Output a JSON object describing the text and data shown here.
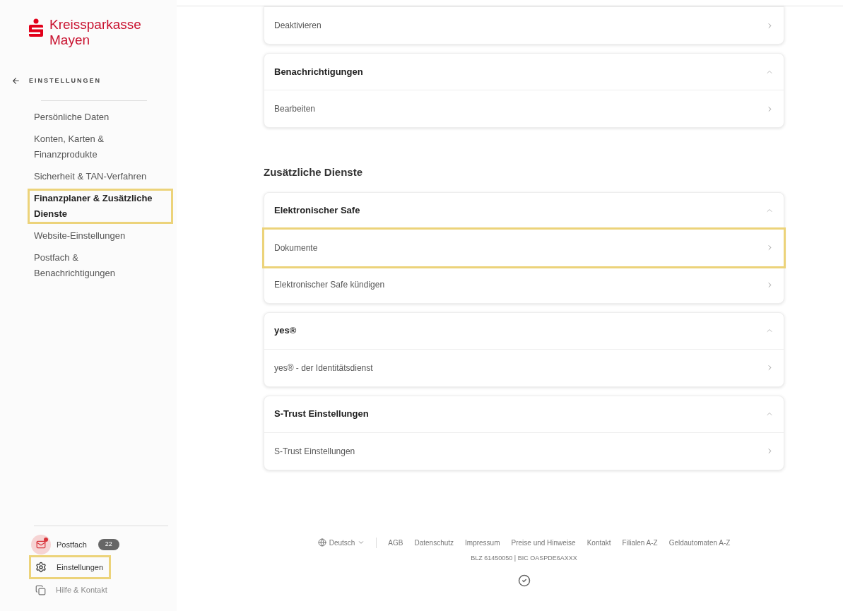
{
  "sidebar": {
    "logo": {
      "line1": "Kreissparkasse",
      "line2": "Mayen"
    },
    "back_label": "EINSTELLUNGEN",
    "items": [
      {
        "label": "Persönliche Daten",
        "selected": false,
        "highlighted": false
      },
      {
        "label": "Konten, Karten & Finanzprodukte",
        "selected": false,
        "highlighted": false
      },
      {
        "label": "Sicherheit & TAN-Verfahren",
        "selected": false,
        "highlighted": false
      },
      {
        "label": "Finanzplaner & Zusätzliche Dienste",
        "selected": true,
        "highlighted": true
      },
      {
        "label": "Website-Einstellungen",
        "selected": false,
        "highlighted": false
      },
      {
        "label": "Postfach & Benachrichtigungen",
        "selected": false,
        "highlighted": false
      }
    ],
    "bottom_items": [
      {
        "kind": "mail",
        "label": "Postfach",
        "badge": "22",
        "highlighted": false
      },
      {
        "kind": "settings",
        "label": "Einstellungen",
        "highlighted": true
      },
      {
        "kind": "help",
        "label": "Hilfe & Kontakt",
        "highlighted": false
      }
    ]
  },
  "main": {
    "sections": [
      {
        "cards": [
          {
            "rows": [
              {
                "label": "Deaktivieren",
                "highlighted": false
              }
            ]
          },
          {
            "header": "Benachrichtigungen",
            "expanded": true,
            "rows": [
              {
                "label": "Bearbeiten",
                "highlighted": false
              }
            ]
          }
        ]
      },
      {
        "title": "Zusätzliche Dienste",
        "cards": [
          {
            "header": "Elektronischer Safe",
            "expanded": true,
            "rows": [
              {
                "label": "Dokumente",
                "highlighted": true
              },
              {
                "label": "Elektronischer Safe kündigen",
                "highlighted": false
              }
            ]
          },
          {
            "header": "yes®",
            "expanded": true,
            "rows": [
              {
                "label": "yes® - der Identitätsdienst",
                "highlighted": false
              }
            ]
          },
          {
            "header": "S-Trust Einstellungen",
            "expanded": true,
            "rows": [
              {
                "label": "S-Trust Einstellungen",
                "highlighted": false
              }
            ]
          }
        ]
      }
    ]
  },
  "footer": {
    "language": "Deutsch",
    "links": [
      "AGB",
      "Datenschutz",
      "Impressum",
      "Preise und Hinweise",
      "Kontakt",
      "Filialen A-Z",
      "Geldautomaten A-Z"
    ],
    "bank_info": "BLZ 61450050 | BIC OASPDE6AXXX"
  }
}
